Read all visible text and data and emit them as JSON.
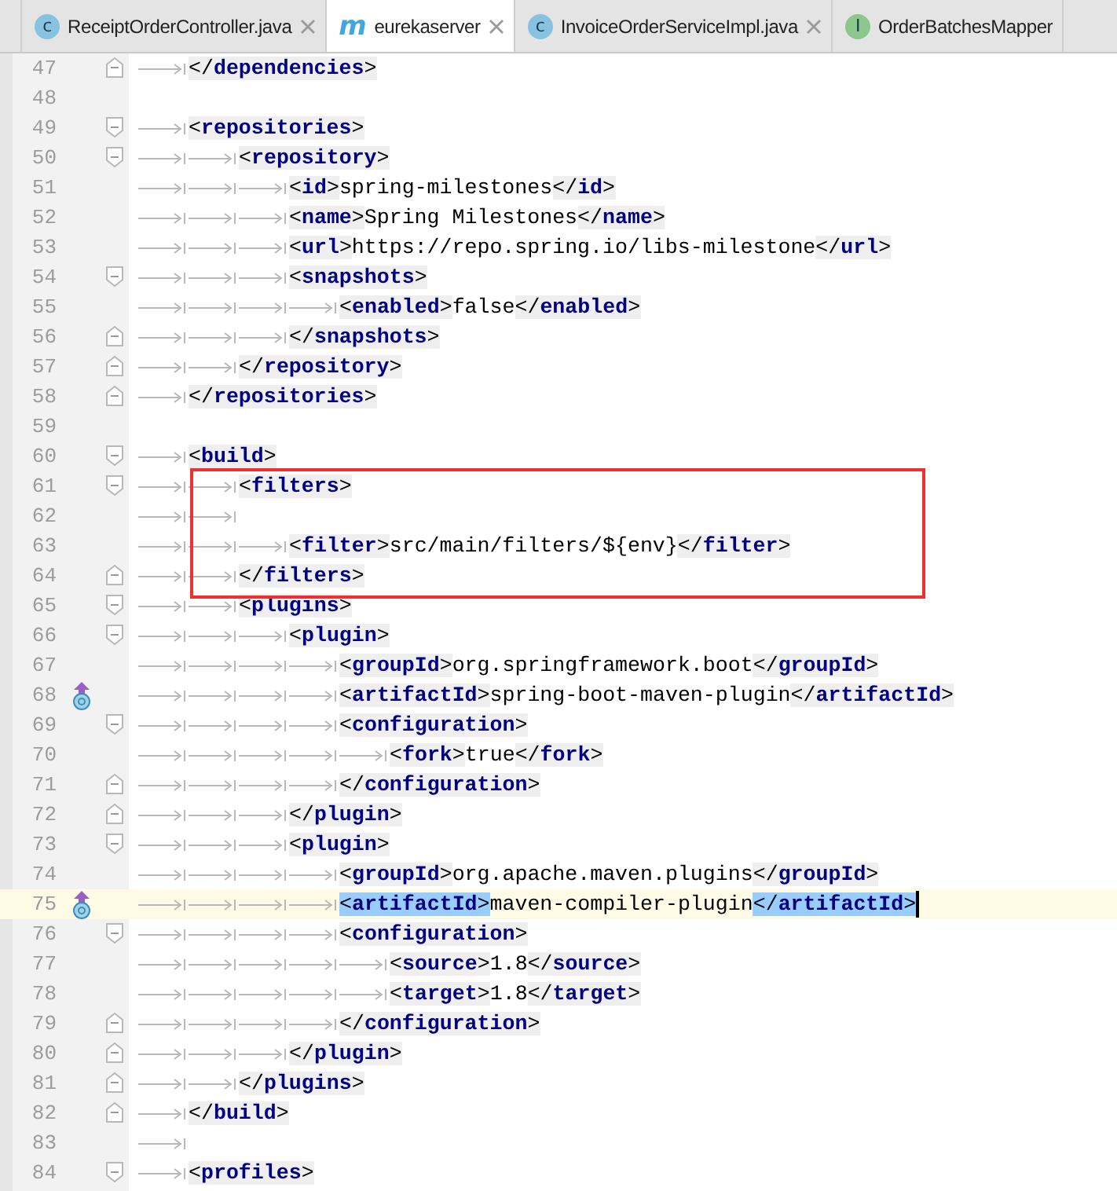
{
  "tabs": [
    {
      "icon_letter": "c",
      "color": "#87c3e0",
      "label": "ReceiptOrderController.java",
      "selected": false,
      "closable": true
    },
    {
      "icon_letter": "m",
      "color": "#3fa8e0",
      "label": "eurekaserver",
      "selected": true,
      "closable": true
    },
    {
      "icon_letter": "c",
      "color": "#87c3e0",
      "label": "InvoiceOrderServiceImpl.java",
      "selected": false,
      "closable": true
    },
    {
      "icon_letter": "I",
      "color": "#8cc78c",
      "label": "OrderBatchesMapper",
      "selected": false,
      "closable": false
    }
  ],
  "editor": {
    "lines": [
      {
        "number": "47",
        "fold_end": true,
        "whitespace": [
          {
            "kind": "tab"
          }
        ],
        "tokens": [
          {
            "kind": "tag",
            "text": "</dependencies>"
          }
        ]
      },
      {
        "number": "48"
      },
      {
        "number": "49",
        "fold_start": true,
        "whitespace": [
          {
            "kind": "tab"
          }
        ],
        "tokens": [
          {
            "kind": "tag",
            "text": "<repositories>"
          }
        ]
      },
      {
        "number": "50",
        "fold_start": true,
        "whitespace": [
          {
            "kind": "tab"
          },
          {
            "kind": "tab"
          }
        ],
        "tokens": [
          {
            "kind": "tag",
            "text": "<repository>"
          }
        ]
      },
      {
        "number": "51",
        "whitespace": [
          {
            "kind": "tab"
          },
          {
            "kind": "tab"
          },
          {
            "kind": "tab"
          }
        ],
        "tokens": [
          {
            "kind": "tag",
            "text": "<id>"
          },
          {
            "kind": "text",
            "text": "spring-milestones"
          },
          {
            "kind": "tag",
            "text": "</id>"
          }
        ]
      },
      {
        "number": "52",
        "whitespace": [
          {
            "kind": "tab"
          },
          {
            "kind": "tab"
          },
          {
            "kind": "tab"
          }
        ],
        "tokens": [
          {
            "kind": "tag",
            "text": "<name>"
          },
          {
            "kind": "text",
            "text": "Spring Milestones"
          },
          {
            "kind": "tag",
            "text": "</name>"
          }
        ]
      },
      {
        "number": "53",
        "whitespace": [
          {
            "kind": "tab"
          },
          {
            "kind": "tab"
          },
          {
            "kind": "tab"
          }
        ],
        "tokens": [
          {
            "kind": "tag",
            "text": "<url>"
          },
          {
            "kind": "text",
            "text": "https://repo.spring.io/libs-milestone"
          },
          {
            "kind": "tag",
            "text": "</url>"
          }
        ]
      },
      {
        "number": "54",
        "fold_start": true,
        "whitespace": [
          {
            "kind": "tab"
          },
          {
            "kind": "tab"
          },
          {
            "kind": "tab"
          }
        ],
        "tokens": [
          {
            "kind": "tag",
            "text": "<snapshots>"
          }
        ]
      },
      {
        "number": "55",
        "whitespace": [
          {
            "kind": "tab"
          },
          {
            "kind": "tab"
          },
          {
            "kind": "tab"
          },
          {
            "kind": "tab"
          }
        ],
        "tokens": [
          {
            "kind": "tag",
            "text": "<enabled>"
          },
          {
            "kind": "text",
            "text": "false"
          },
          {
            "kind": "tag",
            "text": "</enabled>"
          }
        ]
      },
      {
        "number": "56",
        "fold_end": true,
        "whitespace": [
          {
            "kind": "tab"
          },
          {
            "kind": "tab"
          },
          {
            "kind": "tab"
          }
        ],
        "tokens": [
          {
            "kind": "tag",
            "text": "</snapshots>"
          }
        ]
      },
      {
        "number": "57",
        "fold_end": true,
        "whitespace": [
          {
            "kind": "tab"
          },
          {
            "kind": "tab"
          }
        ],
        "tokens": [
          {
            "kind": "tag",
            "text": "</repository>"
          }
        ]
      },
      {
        "number": "58",
        "fold_end": true,
        "whitespace": [
          {
            "kind": "tab"
          }
        ],
        "tokens": [
          {
            "kind": "tag",
            "text": "</repositories>"
          }
        ]
      },
      {
        "number": "59"
      },
      {
        "number": "60",
        "fold_start": true,
        "whitespace": [
          {
            "kind": "tab"
          }
        ],
        "tokens": [
          {
            "kind": "tag",
            "text": "<build>"
          }
        ]
      },
      {
        "number": "61",
        "fold_start": true,
        "boxed": true,
        "whitespace": [
          {
            "kind": "tab"
          },
          {
            "kind": "tab"
          }
        ],
        "tokens": [
          {
            "kind": "tag",
            "text": "<filters>"
          }
        ]
      },
      {
        "number": "62",
        "boxed": true,
        "whitespace": [
          {
            "kind": "tab"
          },
          {
            "kind": "tab"
          }
        ]
      },
      {
        "number": "63",
        "boxed": true,
        "whitespace": [
          {
            "kind": "tab"
          },
          {
            "kind": "tab"
          },
          {
            "kind": "tab"
          }
        ],
        "tokens": [
          {
            "kind": "tag",
            "text": "<filter>"
          },
          {
            "kind": "text",
            "text": "src/main/filters/${env}"
          },
          {
            "kind": "tag",
            "text": "</filter>"
          }
        ]
      },
      {
        "number": "64",
        "fold_end": true,
        "boxed": true,
        "whitespace": [
          {
            "kind": "tab"
          },
          {
            "kind": "tab"
          }
        ],
        "tokens": [
          {
            "kind": "tag",
            "text": "</filters>"
          }
        ]
      },
      {
        "number": "65",
        "fold_start": true,
        "whitespace": [
          {
            "kind": "tab"
          },
          {
            "kind": "tab"
          }
        ],
        "tokens": [
          {
            "kind": "tag",
            "text": "<plugins>"
          }
        ]
      },
      {
        "number": "66",
        "fold_start": true,
        "whitespace": [
          {
            "kind": "tab"
          },
          {
            "kind": "tab"
          },
          {
            "kind": "tab"
          }
        ],
        "tokens": [
          {
            "kind": "tag",
            "text": "<plugin>"
          }
        ]
      },
      {
        "number": "67",
        "whitespace": [
          {
            "kind": "tab"
          },
          {
            "kind": "tab"
          },
          {
            "kind": "tab"
          },
          {
            "kind": "tab"
          }
        ],
        "tokens": [
          {
            "kind": "tag",
            "text": "<groupId>"
          },
          {
            "kind": "text",
            "text": "org.springframework.boot"
          },
          {
            "kind": "tag",
            "text": "</groupId>"
          }
        ]
      },
      {
        "number": "68",
        "overridden": true,
        "whitespace": [
          {
            "kind": "tab"
          },
          {
            "kind": "tab"
          },
          {
            "kind": "tab"
          },
          {
            "kind": "tab"
          }
        ],
        "tokens": [
          {
            "kind": "tag",
            "text": "<artifactId>"
          },
          {
            "kind": "text",
            "text": "spring-boot-maven-plugin"
          },
          {
            "kind": "tag",
            "text": "</artifactId>"
          }
        ]
      },
      {
        "number": "69",
        "fold_start": true,
        "whitespace": [
          {
            "kind": "tab"
          },
          {
            "kind": "tab"
          },
          {
            "kind": "tab"
          },
          {
            "kind": "tab"
          }
        ],
        "tokens": [
          {
            "kind": "tag",
            "text": "<configuration>"
          }
        ]
      },
      {
        "number": "70",
        "whitespace": [
          {
            "kind": "tab"
          },
          {
            "kind": "tab"
          },
          {
            "kind": "tab"
          },
          {
            "kind": "tab"
          },
          {
            "kind": "tab"
          }
        ],
        "tokens": [
          {
            "kind": "tag",
            "text": "<fork>"
          },
          {
            "kind": "text",
            "text": "true"
          },
          {
            "kind": "tag",
            "text": "</fork>"
          }
        ]
      },
      {
        "number": "71",
        "fold_end": true,
        "whitespace": [
          {
            "kind": "tab"
          },
          {
            "kind": "tab"
          },
          {
            "kind": "tab"
          },
          {
            "kind": "tab"
          }
        ],
        "tokens": [
          {
            "kind": "tag",
            "text": "</configuration>"
          }
        ]
      },
      {
        "number": "72",
        "fold_end": true,
        "whitespace": [
          {
            "kind": "tab"
          },
          {
            "kind": "tab"
          },
          {
            "kind": "tab"
          }
        ],
        "tokens": [
          {
            "kind": "tag",
            "text": "</plugin>"
          }
        ]
      },
      {
        "number": "73",
        "fold_start": true,
        "whitespace": [
          {
            "kind": "tab"
          },
          {
            "kind": "tab"
          },
          {
            "kind": "tab"
          }
        ],
        "tokens": [
          {
            "kind": "tag",
            "text": "<plugin>"
          }
        ]
      },
      {
        "number": "74",
        "whitespace": [
          {
            "kind": "tab"
          },
          {
            "kind": "tab"
          },
          {
            "kind": "tab"
          },
          {
            "kind": "tab"
          }
        ],
        "tokens": [
          {
            "kind": "tag",
            "text": "<groupId>"
          },
          {
            "kind": "text",
            "text": "org.apache.maven.plugins"
          },
          {
            "kind": "tag",
            "text": "</groupId>"
          }
        ]
      },
      {
        "number": "75",
        "overridden": true,
        "current": true,
        "caret": true,
        "whitespace": [
          {
            "kind": "tab"
          },
          {
            "kind": "tab"
          },
          {
            "kind": "tab"
          },
          {
            "kind": "tab"
          }
        ],
        "tokens": [
          {
            "kind": "tag",
            "text": "<artifactId>",
            "matched": true
          },
          {
            "kind": "text",
            "text": "maven-compiler-plugin"
          },
          {
            "kind": "tag",
            "text": "</artifactId>",
            "matched": true
          }
        ]
      },
      {
        "number": "76",
        "fold_start": true,
        "whitespace": [
          {
            "kind": "tab"
          },
          {
            "kind": "tab"
          },
          {
            "kind": "tab"
          },
          {
            "kind": "tab"
          }
        ],
        "tokens": [
          {
            "kind": "tag",
            "text": "<configuration>"
          }
        ]
      },
      {
        "number": "77",
        "whitespace": [
          {
            "kind": "tab"
          },
          {
            "kind": "tab"
          },
          {
            "kind": "tab"
          },
          {
            "kind": "tab"
          },
          {
            "kind": "tab"
          }
        ],
        "tokens": [
          {
            "kind": "tag",
            "text": "<source>"
          },
          {
            "kind": "text",
            "text": "1.8"
          },
          {
            "kind": "tag",
            "text": "</source>"
          }
        ]
      },
      {
        "number": "78",
        "whitespace": [
          {
            "kind": "tab"
          },
          {
            "kind": "tab"
          },
          {
            "kind": "tab"
          },
          {
            "kind": "tab"
          },
          {
            "kind": "tab"
          }
        ],
        "tokens": [
          {
            "kind": "tag",
            "text": "<target>"
          },
          {
            "kind": "text",
            "text": "1.8"
          },
          {
            "kind": "tag",
            "text": "</target>"
          }
        ]
      },
      {
        "number": "79",
        "fold_end": true,
        "whitespace": [
          {
            "kind": "tab"
          },
          {
            "kind": "tab"
          },
          {
            "kind": "tab"
          },
          {
            "kind": "tab"
          }
        ],
        "tokens": [
          {
            "kind": "tag",
            "text": "</configuration>"
          }
        ]
      },
      {
        "number": "80",
        "fold_end": true,
        "whitespace": [
          {
            "kind": "tab"
          },
          {
            "kind": "tab"
          },
          {
            "kind": "tab"
          }
        ],
        "tokens": [
          {
            "kind": "tag",
            "text": "</plugin>"
          }
        ]
      },
      {
        "number": "81",
        "fold_end": true,
        "whitespace": [
          {
            "kind": "tab"
          },
          {
            "kind": "tab"
          }
        ],
        "tokens": [
          {
            "kind": "tag",
            "text": "</plugins>"
          }
        ]
      },
      {
        "number": "82",
        "fold_end": true,
        "whitespace": [
          {
            "kind": "tab"
          }
        ],
        "tokens": [
          {
            "kind": "tag",
            "text": "</build>"
          }
        ]
      },
      {
        "number": "83",
        "whitespace": [
          {
            "kind": "tab"
          }
        ]
      },
      {
        "number": "84",
        "fold_start": true,
        "whitespace": [
          {
            "kind": "tab"
          }
        ],
        "tokens": [
          {
            "kind": "tag",
            "text": "<profiles>"
          }
        ]
      }
    ]
  }
}
